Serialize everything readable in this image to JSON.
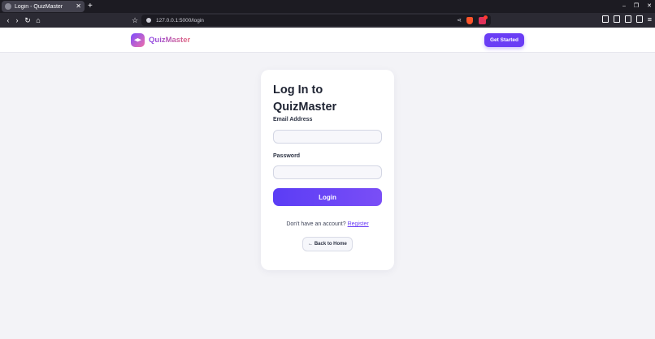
{
  "browser": {
    "tab_title": "Login - QuizMaster",
    "tab_close": "✕",
    "new_tab": "+",
    "url": "127.0.0.1:5000/login",
    "nav_back": "‹",
    "nav_forward": "›",
    "nav_reload": "↻",
    "nav_home": "⌂",
    "bookmark": "☆",
    "share": "⋖",
    "menu": "≡",
    "win_minimize": "–",
    "win_restore": "❐",
    "win_close": "✕",
    "icons": [
      "page-icon",
      "sidebar-icon",
      "wallet-icon",
      "extensions-icon"
    ]
  },
  "header": {
    "brand": "QuizMaster",
    "cta_label": "Get Started",
    "accent": "#6a3df5"
  },
  "login": {
    "title": "Log In to QuizMaster",
    "email_label": "Email Address",
    "email_value": "",
    "password_label": "Password",
    "password_value": "",
    "submit_label": "Login",
    "register_prompt": "Don't have an account?",
    "register_link": "Register",
    "back_label": "← Back to Home"
  }
}
